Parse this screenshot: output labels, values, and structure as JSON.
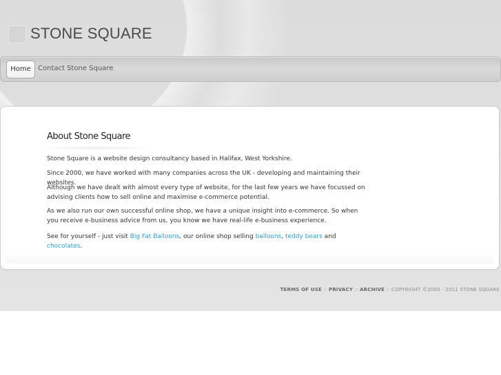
{
  "header": {
    "site_title": "STONE SQUARE"
  },
  "nav": {
    "home": "Home",
    "contact": "Contact Stone Square"
  },
  "main": {
    "heading": "About Stone Square",
    "p1": "Stone Square is a website design consultancy based in Halifax, West Yorkshire.",
    "p2": "Since 2000, we have worked with many companies across the UK - developing and maintaining their websites.",
    "p3": "Although we have dealt with almost every type of website, for the last few years we have focussed on advising clients how to sell online and maximise e-commerce potential.",
    "p4": "As we also run our own successful online shop, we have a unique insight into e-commerce. So when you receive e-business advice from us, you know we have real-life e-business experience.",
    "p5": {
      "text1": "See for yourself - just visit ",
      "link_bigfat": "Big Fat Balloons",
      "text2": ", our online shop selling ",
      "link_balloons": "balloons",
      "sep": ", ",
      "link_teddy": "teddy bears",
      "and": " and ",
      "link_chocolates": "chocolates",
      "end": "."
    }
  },
  "footer": {
    "terms": "TERMS OF USE",
    "sep1": " :: ",
    "privacy": "PRIVACY",
    "sep2": " :: ",
    "archive": "ARCHIVE",
    "copyright": " :: COPYRIGHT ©2000 - 2011 STONE SQUARE"
  },
  "colors": {
    "link": "#2a9fd6",
    "text": "#333333",
    "background": "#dcdcdc"
  }
}
